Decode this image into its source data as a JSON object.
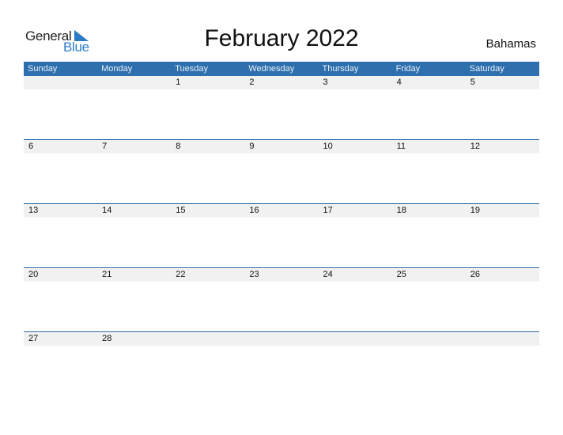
{
  "logo": {
    "part1": "General",
    "part2": "Blue",
    "color": "#2a7bc4"
  },
  "title": "February 2022",
  "country": "Bahamas",
  "header_color": "#2e6fad",
  "days": [
    "Sunday",
    "Monday",
    "Tuesday",
    "Wednesday",
    "Thursday",
    "Friday",
    "Saturday"
  ],
  "weeks": [
    [
      "",
      "",
      "1",
      "2",
      "3",
      "4",
      "5"
    ],
    [
      "6",
      "7",
      "8",
      "9",
      "10",
      "11",
      "12"
    ],
    [
      "13",
      "14",
      "15",
      "16",
      "17",
      "18",
      "19"
    ],
    [
      "20",
      "21",
      "22",
      "23",
      "24",
      "25",
      "26"
    ],
    [
      "27",
      "28",
      "",
      "",
      "",
      "",
      ""
    ]
  ]
}
